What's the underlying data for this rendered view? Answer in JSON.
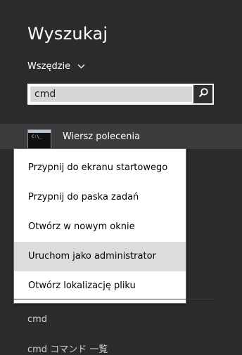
{
  "header": {
    "title": "Wyszukaj",
    "scope_label": "Wszędzie"
  },
  "search": {
    "value": "cmd",
    "placeholder": ""
  },
  "result": {
    "app_name": "Wiersz polecenia",
    "icon": "command-prompt-icon",
    "icon_text": "C:\\_"
  },
  "context_menu": {
    "items": [
      {
        "label": "Przypnij do ekranu startowego"
      },
      {
        "label": "Przypnij do paska zadań"
      },
      {
        "label": "Otwórz w nowym oknie"
      },
      {
        "label": "Uruchom jako administrator",
        "highlighted": true
      },
      {
        "label": "Otwórz lokalizację pliku"
      }
    ]
  },
  "suggestions": [
    {
      "label": "cmd"
    },
    {
      "label": "cmd コマンド 一覧"
    }
  ],
  "colors": {
    "background": "#2b2b2b",
    "menu_background": "#ffffff",
    "menu_hover": "#dcdcdc",
    "search_field": "#d6d6d6"
  }
}
